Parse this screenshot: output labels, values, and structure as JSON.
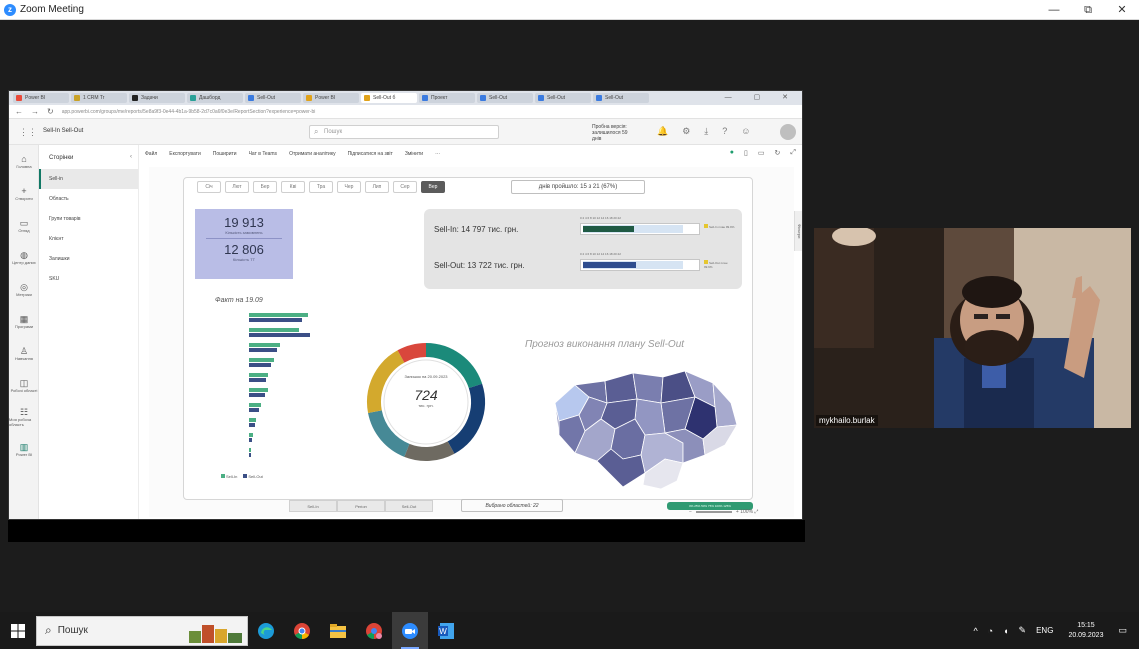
{
  "window": {
    "title": "Zoom Meeting",
    "controls": [
      "—",
      "⧉",
      "✕"
    ]
  },
  "browser": {
    "tabs": [
      "Power BI",
      "1 CRM Tr",
      "Задачи",
      "Дашборд",
      "Sell-Out",
      "Power BI",
      "Sell-Out б",
      "Проект",
      "Sell-Out",
      "Sell-Out",
      "Sell-Out"
    ],
    "url": "app.powerbi.com/groups/me/reports/5e8a9f3-0e44-4b1a-9b58-2d7c0a6f0e3e/ReportSection?experience=power-bi"
  },
  "pbi": {
    "report_name": "Sell-In Sell-Out",
    "search_placeholder": "Пошук",
    "trial": "Пробна версія: залишилося 59 днів",
    "left_nav": [
      "Головна",
      "Створити",
      "Огляд",
      "Центр даних",
      "Метрики",
      "Програми",
      "Навчання",
      "Робочі області",
      "Моя робоча область",
      "Power BI"
    ],
    "pages_title": "Сторінки",
    "pages": [
      "Sell-in",
      "Область",
      "Групи товарів",
      "Клієнт",
      "Залишки",
      "SKU"
    ],
    "active_page": 0,
    "toolbar": [
      "Файл",
      "Експортувати",
      "Поширити",
      "Чат в Teams",
      "Отримати аналітику",
      "Підписатися на звіт",
      "Змінити"
    ]
  },
  "report": {
    "months": [
      "Січ",
      "Лют",
      "Бер",
      "Кві",
      "Тра",
      "Чер",
      "Лип",
      "Сер",
      "Вер"
    ],
    "selected_month": 8,
    "working_days": "днів пройшло: 15 з 21 (67%)",
    "kpi": {
      "top_value": "19 913",
      "top_label": "Кількість замовлень",
      "bottom_value": "12 806",
      "bottom_label": "Кількість ТТ"
    },
    "sell_in": {
      "label": "Sell-In: 14 797 тис. грн.",
      "fill_pct": 0.44,
      "scale": "0   2   4   6   8   10   12   14   16   18   20   22",
      "legend": "Sell-In план 99.9%"
    },
    "sell_out": {
      "label": "Sell-Out: 13 722 тис. грн.",
      "fill_pct": 0.46,
      "scale": "0   2   4   6   8   10   12   14   16   18   20   22",
      "legend": "Sell-Out план 99.9%"
    },
    "fact_title": "Факт на 19.09",
    "bar_chart_legend": [
      "Sell-In",
      "Sell-Out"
    ],
    "donut": {
      "center_label": "Залишок на 20.09.2023",
      "center_value": "724",
      "center_unit": "тис. грн.",
      "colors": [
        "#1b8a7a",
        "#163e73",
        "#6e6a61",
        "#468996",
        "#d3a92d",
        "#d9473c"
      ]
    },
    "forecast_title": "Прогноз виконання плану Sell-Out",
    "filter_tabs": [
      "Sell-In",
      "Регіон",
      "Sell-Out"
    ],
    "regions_selected": "Вибрано областей: 22",
    "map_legend": "0% 25% 50% 75% 100% 125%",
    "zoom_level": "100%",
    "filters_label": "Фільтри"
  },
  "video": {
    "participant_name": "mykhailo.burlak"
  },
  "taskbar": {
    "search_placeholder": "Пошук",
    "lang": "ENG",
    "time": "15:15",
    "date": "20.09.2023"
  }
}
